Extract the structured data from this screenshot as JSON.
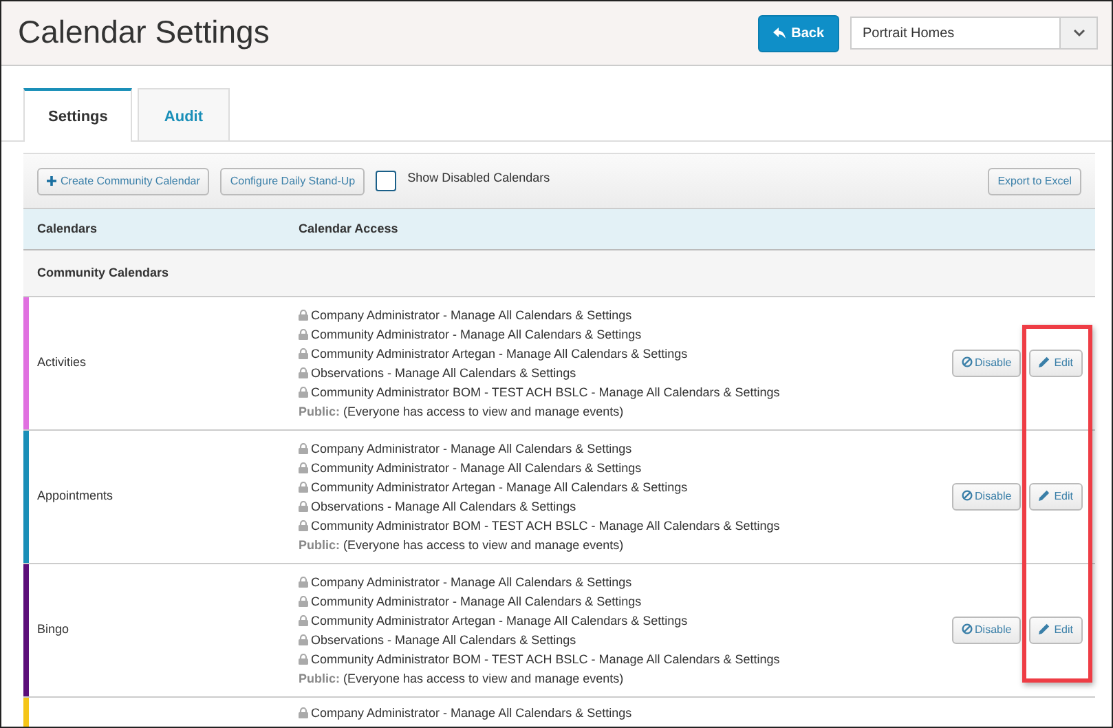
{
  "header": {
    "title": "Calendar Settings",
    "back_button": "Back",
    "community_select": {
      "value": "Portrait Homes"
    }
  },
  "tabs": [
    {
      "label": "Settings",
      "selected": true
    },
    {
      "label": "Audit",
      "selected": false
    }
  ],
  "toolbar": {
    "create_button": "Create Community Calendar",
    "configure_button": "Configure Daily Stand-Up",
    "show_disabled": {
      "label": "Show Disabled Calendars",
      "checked": false
    },
    "export_button": "Export to Excel"
  },
  "table": {
    "columns": [
      "Calendars",
      "Calendar Access"
    ],
    "group": "Community Calendars",
    "rows": [
      {
        "name": "Activities",
        "color": "#e070e0",
        "access": [
          "Company Administrator - Manage All Calendars & Settings",
          "Community Administrator - Manage All Calendars & Settings",
          "Community Administrator Artegan - Manage All Calendars & Settings",
          "Observations - Manage All Calendars & Settings",
          "Community Administrator BOM - TEST ACH BSLC - Manage All Calendars & Settings"
        ],
        "public_label": "Public:",
        "public_text": "(Everyone has access to view and manage events)",
        "disable_button": "Disable",
        "edit_button": "Edit"
      },
      {
        "name": "Appointments",
        "color": "#1a8fb8",
        "access": [
          "Company Administrator - Manage All Calendars & Settings",
          "Community Administrator - Manage All Calendars & Settings",
          "Community Administrator Artegan - Manage All Calendars & Settings",
          "Observations - Manage All Calendars & Settings",
          "Community Administrator BOM - TEST ACH BSLC - Manage All Calendars & Settings"
        ],
        "public_label": "Public:",
        "public_text": "(Everyone has access to view and manage events)",
        "disable_button": "Disable",
        "edit_button": "Edit"
      },
      {
        "name": "Bingo",
        "color": "#5c0f7a",
        "access": [
          "Company Administrator - Manage All Calendars & Settings",
          "Community Administrator - Manage All Calendars & Settings",
          "Community Administrator Artegan - Manage All Calendars & Settings",
          "Observations - Manage All Calendars & Settings",
          "Community Administrator BOM - TEST ACH BSLC - Manage All Calendars & Settings"
        ],
        "public_label": "Public:",
        "public_text": "(Everyone has access to view and manage events)",
        "disable_button": "Disable",
        "edit_button": "Edit"
      },
      {
        "color": "#f5c518",
        "access": [
          "Company Administrator - Manage All Calendars & Settings"
        ]
      }
    ]
  },
  "annotation": {
    "kind": "highlight"
  }
}
